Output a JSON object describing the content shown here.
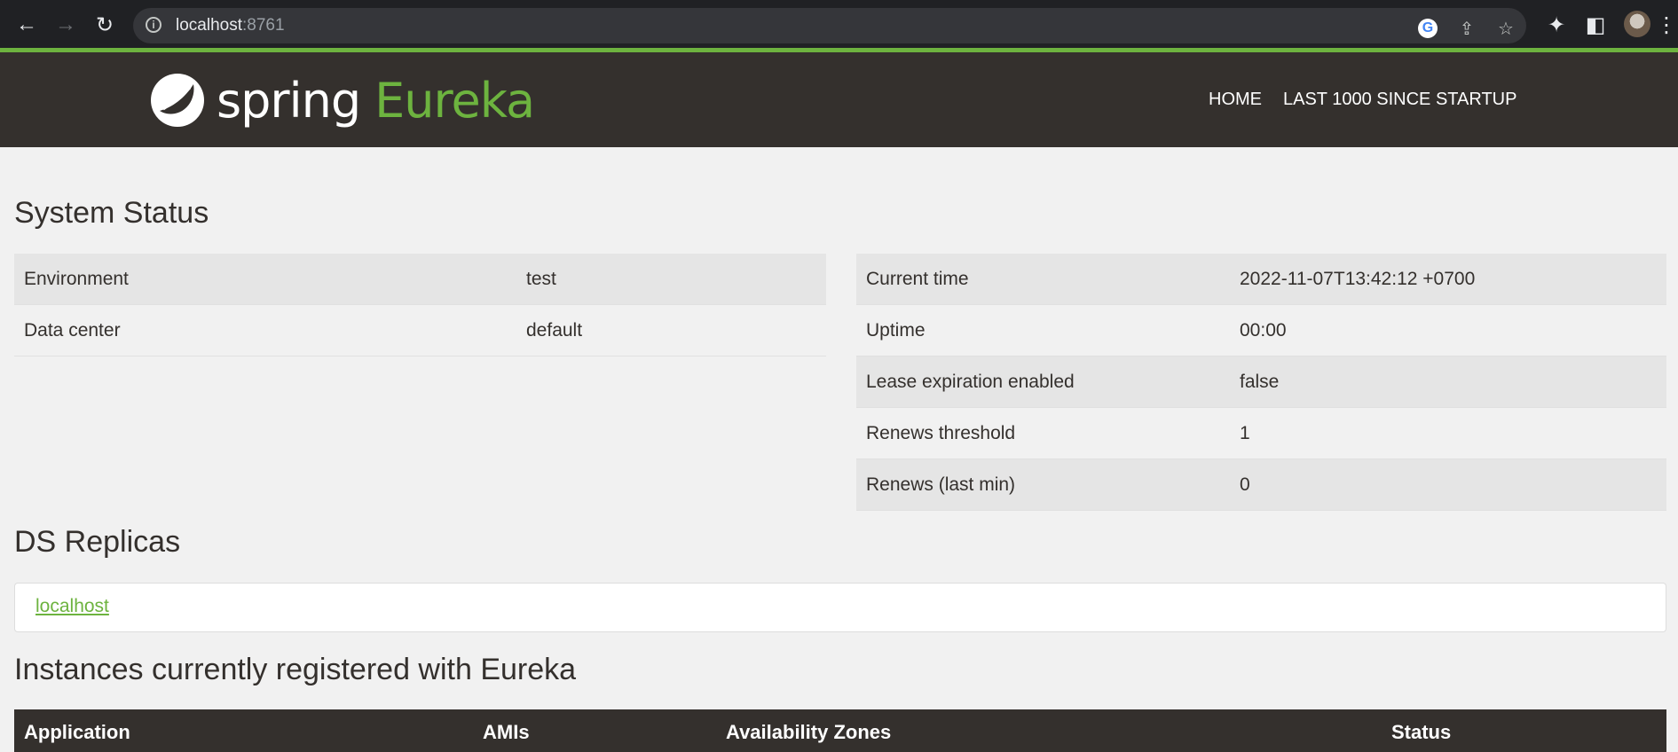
{
  "browser": {
    "url_host": "localhost",
    "url_port": ":8761",
    "icons": [
      "back-arrow-icon",
      "forward-arrow-icon",
      "reload-icon",
      "site-info-icon",
      "google-icon",
      "share-icon",
      "bookmark-star-icon",
      "extensions-icon",
      "side-panel-icon",
      "profile-avatar",
      "menu-dots-icon"
    ]
  },
  "navbar": {
    "logo_word1": "spring",
    "logo_word2": "Eureka",
    "links": [
      {
        "label": "HOME"
      },
      {
        "label": "LAST 1000 SINCE STARTUP"
      }
    ]
  },
  "system_status": {
    "title": "System Status",
    "left": [
      {
        "key": "Environment",
        "value": "test"
      },
      {
        "key": "Data center",
        "value": "default"
      }
    ],
    "right": [
      {
        "key": "Current time",
        "value": "2022-11-07T13:42:12 +0700"
      },
      {
        "key": "Uptime",
        "value": "00:00"
      },
      {
        "key": "Lease expiration enabled",
        "value": "false"
      },
      {
        "key": "Renews threshold",
        "value": "1"
      },
      {
        "key": "Renews (last min)",
        "value": "0"
      }
    ]
  },
  "ds_replicas": {
    "title": "DS Replicas",
    "link": "localhost"
  },
  "instances": {
    "title": "Instances currently registered with Eureka",
    "columns": [
      "Application",
      "AMIs",
      "Availability Zones",
      "Status"
    ]
  },
  "colors": {
    "brand_green": "#6db33f",
    "navbar_bg": "#34302d",
    "page_bg": "#f1f1f1"
  }
}
